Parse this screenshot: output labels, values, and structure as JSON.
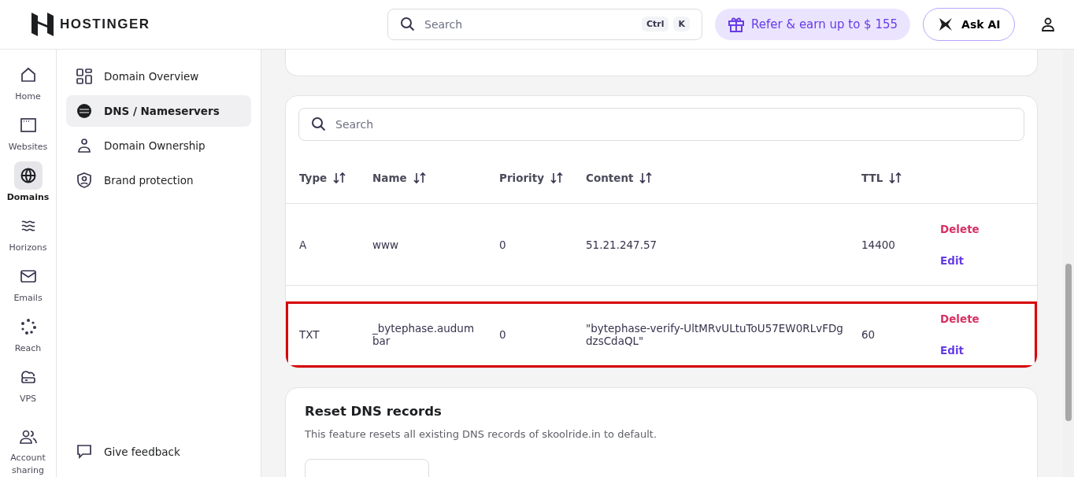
{
  "header": {
    "logo": "HOSTINGER",
    "search": {
      "placeholder": "Search",
      "keys": [
        "Ctrl",
        "K"
      ]
    },
    "refer": "Refer & earn up to $ 155",
    "ask_ai": "Ask AI"
  },
  "rail": [
    {
      "label": "Home",
      "kind": "home",
      "selected": false
    },
    {
      "label": "Websites",
      "kind": "window",
      "selected": false
    },
    {
      "label": "Domains",
      "kind": "globe",
      "selected": true
    },
    {
      "label": "Horizons",
      "kind": "waves",
      "selected": false
    },
    {
      "label": "Emails",
      "kind": "mail",
      "selected": false
    },
    {
      "label": "Reach",
      "kind": "dots",
      "selected": false
    },
    {
      "label": "VPS",
      "kind": "cloud",
      "selected": false
    },
    {
      "label": "Account sharing",
      "kind": "users",
      "selected": false
    }
  ],
  "sidebar": {
    "items": [
      {
        "label": "Domain Overview",
        "kind": "grid",
        "selected": false
      },
      {
        "label": "DNS / Nameservers",
        "kind": "dns",
        "selected": true
      },
      {
        "label": "Domain Ownership",
        "kind": "person",
        "selected": false
      },
      {
        "label": "Brand protection",
        "kind": "shield",
        "selected": false
      }
    ],
    "feedback": "Give feedback"
  },
  "records": {
    "search": {
      "placeholder": "Search"
    },
    "columns": [
      "Type",
      "Name",
      "Priority",
      "Content",
      "TTL"
    ],
    "rows": [
      {
        "cells": [
          "A",
          "www",
          "0",
          "51.21.247.57",
          "14400"
        ],
        "actions": [
          "Delete",
          "Edit"
        ],
        "highlighted": false
      },
      {
        "cells": [
          "TXT",
          "_bytephase.audumbar",
          "0",
          "\"bytephase-verify-UltMRvULtuToU57EW0RLvFDgdzsCdaQL\"",
          "60"
        ],
        "actions": [
          "Delete",
          "Edit"
        ],
        "highlighted": true
      }
    ]
  },
  "reset": {
    "title": "Reset DNS records",
    "description": "This feature resets all existing DNS records of skoolride.in to default."
  }
}
